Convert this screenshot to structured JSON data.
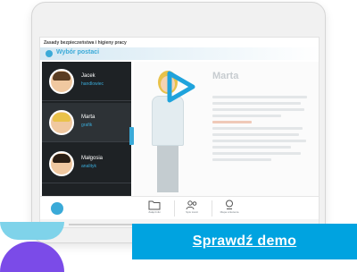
{
  "course": {
    "title": "Zasady bezpieczeństwa i higieny pracy",
    "section_title": "Wybór postaci"
  },
  "characters": [
    {
      "name": "Jacek",
      "role": "handlowiec"
    },
    {
      "name": "Marta",
      "role": "grafik"
    },
    {
      "name": "Małgosia",
      "role": "analityk"
    }
  ],
  "panel": {
    "character_title": "Marta"
  },
  "toolbar": {
    "items": [
      {
        "label": "Załączniki",
        "icon": "folder-icon"
      },
      {
        "label": "Spis treści",
        "icon": "people-icon"
      },
      {
        "label": "Mapa szkolenia",
        "icon": "location-pin-icon"
      }
    ]
  },
  "cta": {
    "label": "Sprawdź demo"
  },
  "colors": {
    "accent": "#3aaad8",
    "cta_background": "#00a3e0",
    "sidebar": "#1e2225",
    "decor_blue": "#7fd3ea",
    "decor_purple": "#7b4be8"
  }
}
